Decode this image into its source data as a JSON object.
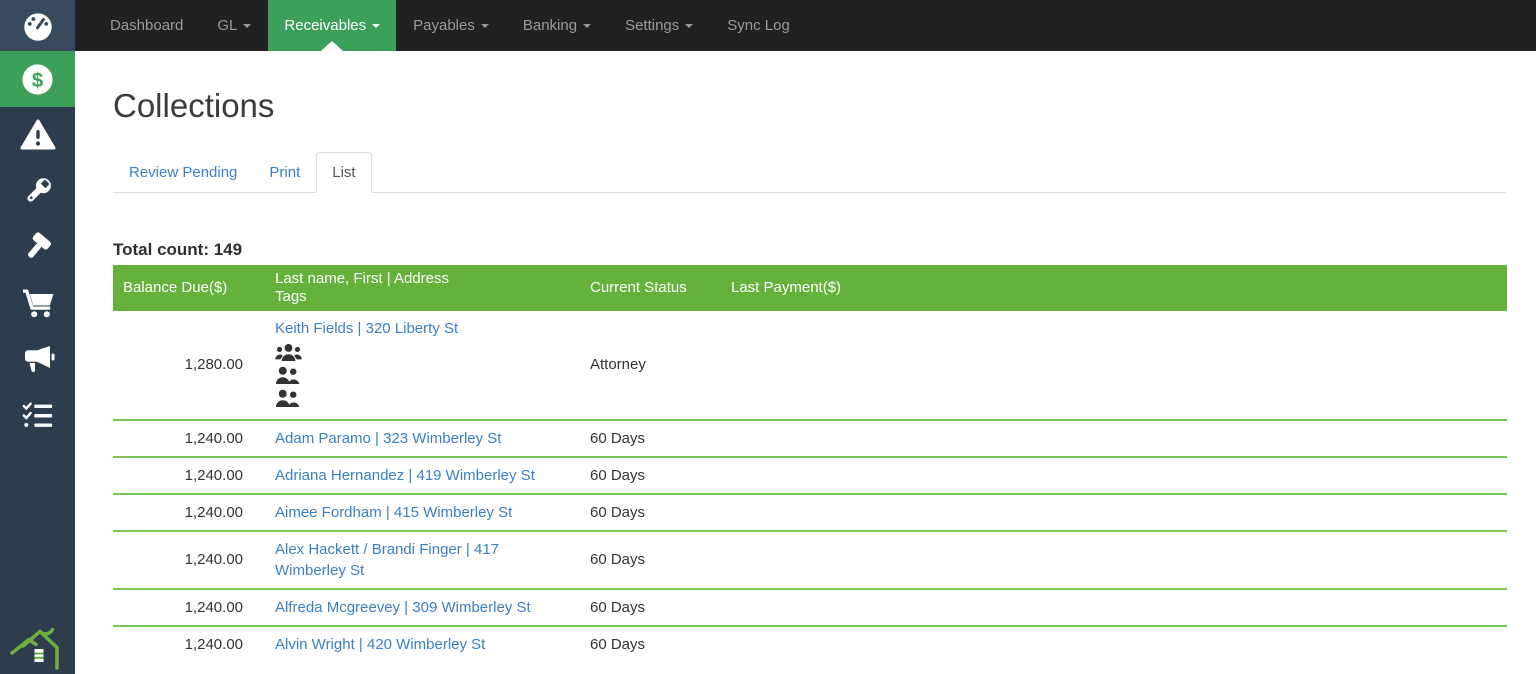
{
  "page": {
    "title": "Collections"
  },
  "topnav": {
    "items": [
      {
        "label": "Dashboard",
        "caret": false,
        "active": false
      },
      {
        "label": "GL",
        "caret": true,
        "active": false
      },
      {
        "label": "Receivables",
        "caret": true,
        "active": true
      },
      {
        "label": "Payables",
        "caret": true,
        "active": false
      },
      {
        "label": "Banking",
        "caret": true,
        "active": false
      },
      {
        "label": "Settings",
        "caret": true,
        "active": false
      },
      {
        "label": "Sync Log",
        "caret": false,
        "active": false
      }
    ]
  },
  "sidebar": {
    "icons": [
      "gauge-icon",
      "dollar-circle-icon",
      "warning-triangle-icon",
      "wrench-icon",
      "hammer-icon",
      "shopping-cart-icon",
      "megaphone-icon",
      "tasks-checklist-icon",
      "house-logo-icon"
    ],
    "active_item": "dollar-circle-icon"
  },
  "tabs": [
    {
      "label": "Review Pending",
      "active": false
    },
    {
      "label": "Print",
      "active": false
    },
    {
      "label": "List",
      "active": true
    }
  ],
  "summary": {
    "total_count": "Total count: 149"
  },
  "table": {
    "headers": {
      "balance": "Balance Due($)",
      "name_line1": "Last name, First | Address",
      "name_line2": "Tags",
      "status": "Current Status",
      "last_payment": "Last Payment($)"
    },
    "rows": [
      {
        "balance": "1,280.00",
        "name": "Keith Fields | 320 Liberty St",
        "status": "Attorney",
        "last_payment": "",
        "tag_icons": [
          "users-icon",
          "users-icon",
          "users-icon"
        ]
      },
      {
        "balance": "1,240.00",
        "name": "Adam Paramo | 323 Wimberley St",
        "status": "60 Days",
        "last_payment": ""
      },
      {
        "balance": "1,240.00",
        "name": "Adriana Hernandez | 419 Wimberley St",
        "status": "60 Days",
        "last_payment": ""
      },
      {
        "balance": "1,240.00",
        "name": "Aimee Fordham | 415 Wimberley St",
        "status": "60 Days",
        "last_payment": ""
      },
      {
        "balance": "1,240.00",
        "name": "Alex Hackett / Brandi Finger | 417 Wimberley St",
        "status": "60 Days",
        "last_payment": ""
      },
      {
        "balance": "1,240.00",
        "name": "Alfreda Mcgreevey | 309 Wimberley St",
        "status": "60 Days",
        "last_payment": ""
      },
      {
        "balance": "1,240.00",
        "name": "Alvin Wright | 420 Wimberley St",
        "status": "60 Days",
        "last_payment": ""
      }
    ]
  },
  "colors": {
    "accent_green": "#3c9f5a",
    "table_header_green": "#64b23c",
    "row_border_green": "#7dc653",
    "link_blue": "#3b80c4",
    "topbar_bg": "#212121",
    "sidebar_bg": "#2e3d4e"
  }
}
